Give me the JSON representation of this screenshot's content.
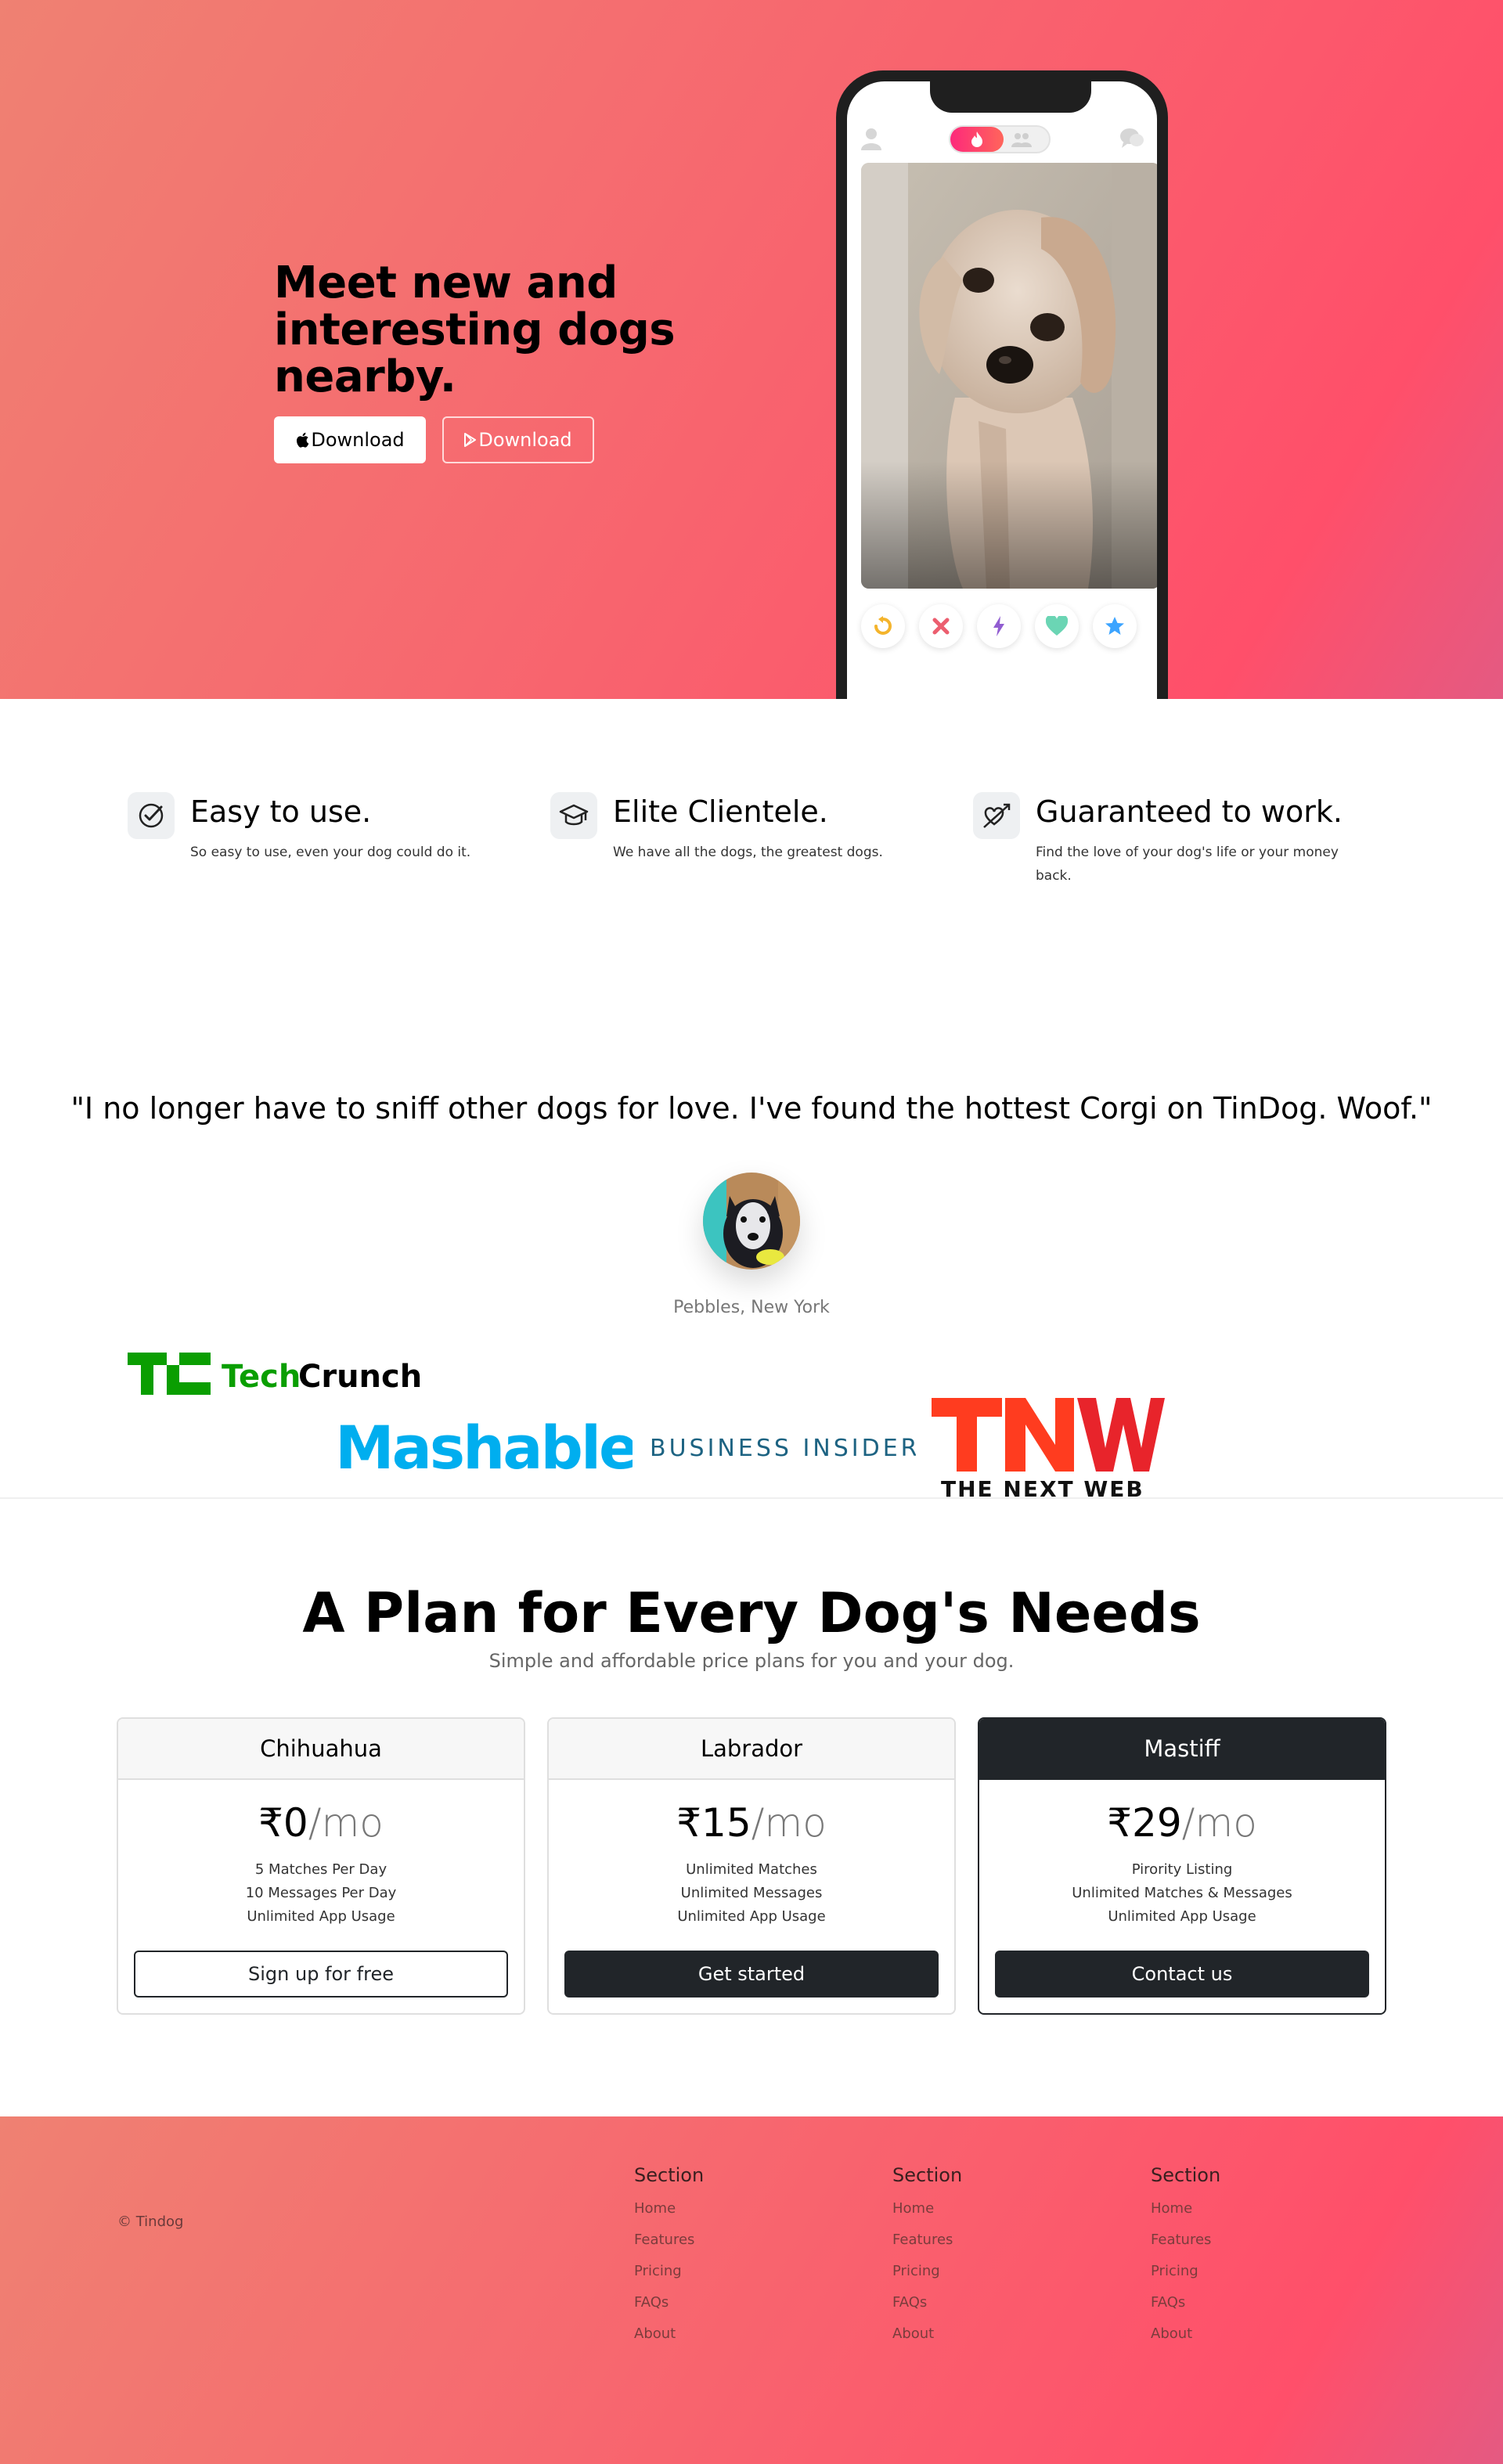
{
  "hero": {
    "title": "Meet new and interesting dogs nearby.",
    "download_apple_label": "Download",
    "download_google_label": "Download",
    "accent": "#ff4f6a"
  },
  "features": [
    {
      "icon": "check-circle-icon",
      "title": "Easy to use.",
      "text": "So easy to use, even your dog could do it."
    },
    {
      "icon": "graduation-cap-icon",
      "title": "Elite Clientele.",
      "text": "We have all the dogs, the greatest dogs."
    },
    {
      "icon": "heart-arrow-icon",
      "title": "Guaranteed to work.",
      "text": "Find the love of your dog's life or your money back."
    }
  ],
  "testimonial": {
    "quote": "\"I no longer have to sniff other dogs for love. I've found the hottest Corgi on TinDog. Woof.\"",
    "author": "Pebbles, New York"
  },
  "press": {
    "techcrunch": "TechCrunch",
    "mashable": "Mashable",
    "business_insider": "BUSINESS INSIDER",
    "tnw": "TNW",
    "tnw_sub": "THE NEXT WEB"
  },
  "pricing": {
    "title": "A Plan for Every Dog's Needs",
    "subtitle": "Simple and affordable price plans for you and your dog.",
    "plans": [
      {
        "name": "Chihuahua",
        "price": "₹0",
        "per": "/mo",
        "features": [
          "5 Matches Per Day",
          "10 Messages Per Day",
          "Unlimited App Usage"
        ],
        "cta": "Sign up for free"
      },
      {
        "name": "Labrador",
        "price": "₹15",
        "per": "/mo",
        "features": [
          "Unlimited Matches",
          "Unlimited Messages",
          "Unlimited App Usage"
        ],
        "cta": "Get started"
      },
      {
        "name": "Mastiff",
        "price": "₹29",
        "per": "/mo",
        "features": [
          "Pirority Listing",
          "Unlimited Matches & Messages",
          "Unlimited App Usage"
        ],
        "cta": "Contact us"
      }
    ]
  },
  "footer": {
    "copyright": "© Tindog",
    "columns": [
      {
        "title": "Section",
        "links": [
          "Home",
          "Features",
          "Pricing",
          "FAQs",
          "About"
        ]
      },
      {
        "title": "Section",
        "links": [
          "Home",
          "Features",
          "Pricing",
          "FAQs",
          "About"
        ]
      },
      {
        "title": "Section",
        "links": [
          "Home",
          "Features",
          "Pricing",
          "FAQs",
          "About"
        ]
      }
    ]
  }
}
